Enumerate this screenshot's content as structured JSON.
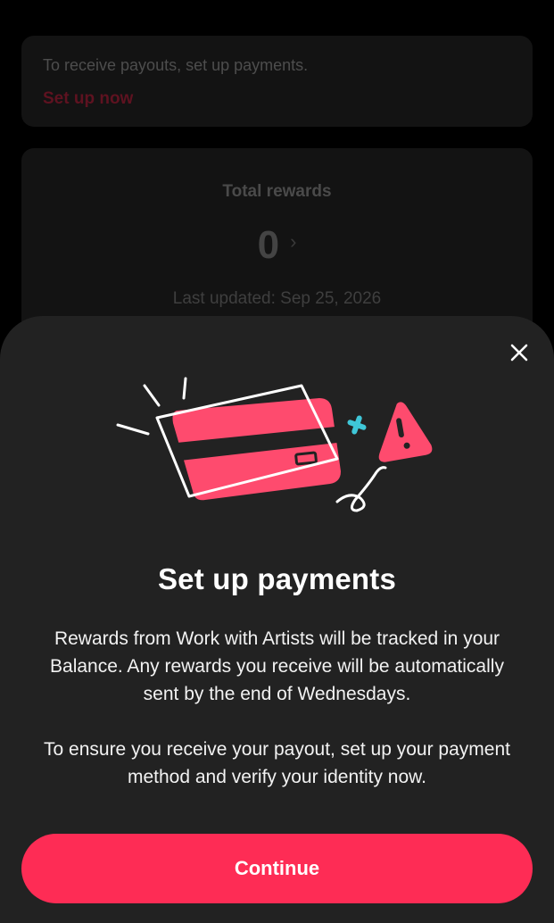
{
  "background": {
    "payout_notice": {
      "text": "To receive payouts, set up payments.",
      "link_label": "Set up now"
    },
    "rewards": {
      "title": "Total rewards",
      "value": "0",
      "chevron": "›",
      "updated": "Last updated: Sep 25, 2026"
    }
  },
  "sheet": {
    "close_icon": "close-icon",
    "illustration_icon": "credit-card-warning-illustration",
    "title": "Set up payments",
    "paragraph_1": "Rewards from Work with Artists will be tracked in your Balance. Any rewards you receive will be automatically sent by the end of Wednesdays.",
    "paragraph_2": "To ensure you receive your payout, set up your payment method and verify your identity now.",
    "continue_label": "Continue"
  },
  "colors": {
    "accent": "#fe2c55",
    "sheet_background": "#222222",
    "card_pink": "#fe4b6e",
    "sparkle_teal": "#3fc7d8"
  }
}
